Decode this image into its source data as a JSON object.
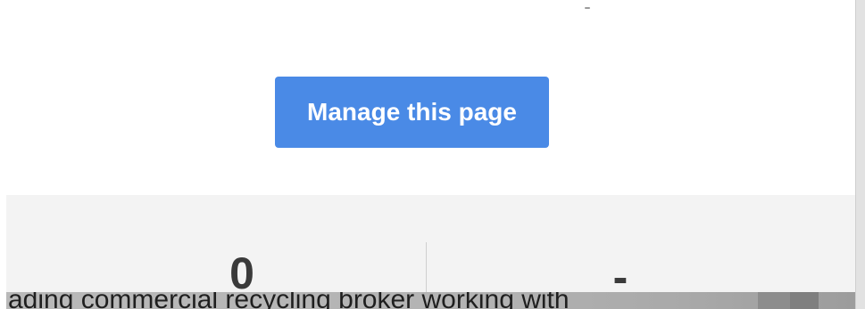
{
  "header": {
    "manage_button_label": "Manage this page"
  },
  "stats": {
    "left_value": "0",
    "right_value": "-"
  },
  "overlay": {
    "text": "ading commercial recycling broker working with"
  },
  "colors": {
    "button_bg": "#4a8ae6",
    "button_text": "#ffffff",
    "stats_band_bg": "#f3f3f3",
    "stat_value_text": "#3a3a3a",
    "overlay_bg": "#b3b3b3"
  }
}
